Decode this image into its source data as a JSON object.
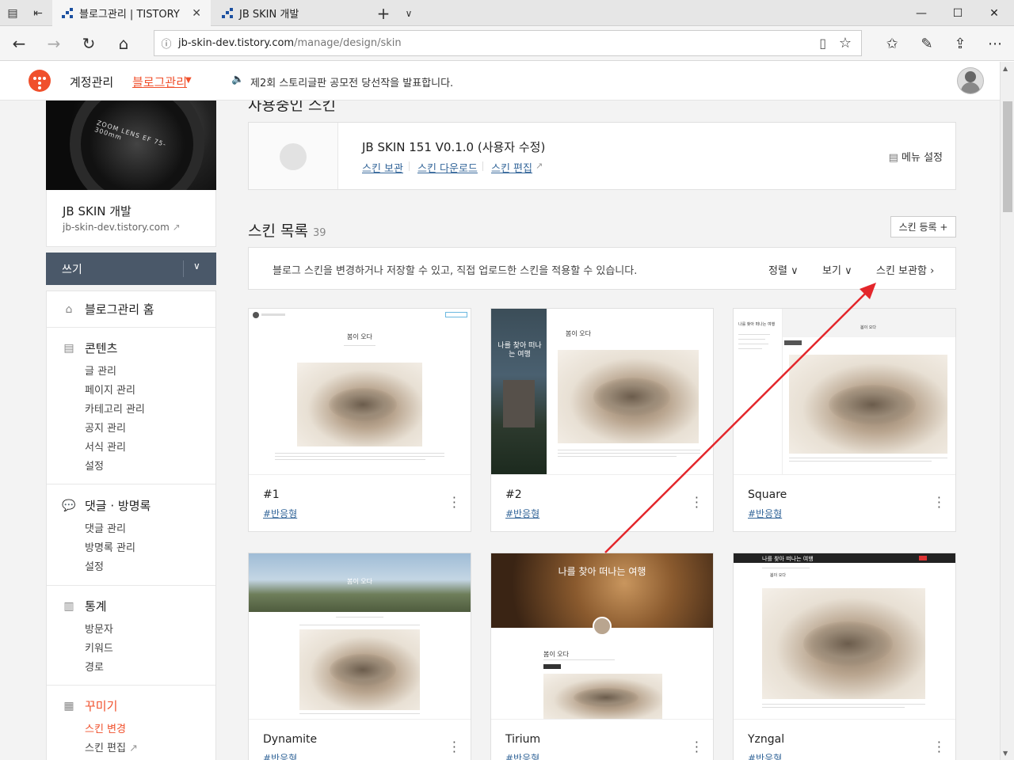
{
  "browser": {
    "tabs": [
      {
        "title": "블로그관리 | TISTORY",
        "active": true
      },
      {
        "title": "JB SKIN 개발",
        "active": false
      }
    ],
    "new_tab_label": "+",
    "url_host": "jb-skin-dev.tistory.com",
    "url_path": "/manage/design/skin"
  },
  "topbar": {
    "account_label": "계정관리",
    "blog_manage_label": "블로그관리",
    "notice": "제2회 스토리글판 공모전 당선작을 발표합니다."
  },
  "sidebar": {
    "blog_title": "JB SKIN 개발",
    "blog_url": "jb-skin-dev.tistory.com",
    "write_label": "쓰기",
    "home_label": "블로그관리 홈",
    "content": {
      "label": "콘텐츠",
      "items": [
        "글 관리",
        "페이지 관리",
        "카테고리 관리",
        "공지 관리",
        "서식 관리",
        "설정"
      ]
    },
    "comments": {
      "label": "댓글 · 방명록",
      "items": [
        "댓글 관리",
        "방명록 관리",
        "설정"
      ]
    },
    "stats": {
      "label": "통계",
      "items": [
        "방문자",
        "키워드",
        "경로"
      ]
    },
    "decorate": {
      "label": "꾸미기",
      "items": [
        "스킨 변경",
        "스킨 편집"
      ]
    }
  },
  "main": {
    "using_title": "사용중인 스킨",
    "using_skin_name": "JB SKIN 151 V0.1.0 (사용자 수정)",
    "using_links": [
      "스킨 보관",
      "스킨 다운로드",
      "스킨 편집"
    ],
    "menu_setting": "메뉴 설정",
    "list_title": "스킨 목록",
    "list_count": "39",
    "register_label": "스킨 등록 +",
    "info_text": "블로그 스킨을 변경하거나 저장할 수 있고, 직접 업로드한 스킨을 적용할 수 있습니다.",
    "sort_label": "정렬",
    "view_label": "보기",
    "archive_label": "스킨 보관함",
    "cards": [
      {
        "name": "#1",
        "tag": "#반응형",
        "post_title": "봄이 오다"
      },
      {
        "name": "#2",
        "tag": "#반응형",
        "post_title": "봄이 오다",
        "side_text": "나를 찾아 떠나는 여행"
      },
      {
        "name": "Square",
        "tag": "#반응형",
        "post_title": "봄이 오다",
        "side_text": "나를 찾아 떠나는 여행"
      },
      {
        "name": "Dynamite",
        "tag": "#반응형",
        "post_title": "봄이 오다"
      },
      {
        "name": "Tirium",
        "tag": "#반응형",
        "post_title": "봄이 오다",
        "banner_text": "나를 찾아 떠나는 여행"
      },
      {
        "name": "Yzngal",
        "tag": "#반응형",
        "post_title": "봄이 오다",
        "banner_text": "나를 찾아 떠나는 여행"
      }
    ]
  },
  "colors": {
    "accent": "#f0502c",
    "link": "#35679a",
    "write_btn": "#4a5869",
    "arrow": "#e3262b"
  }
}
